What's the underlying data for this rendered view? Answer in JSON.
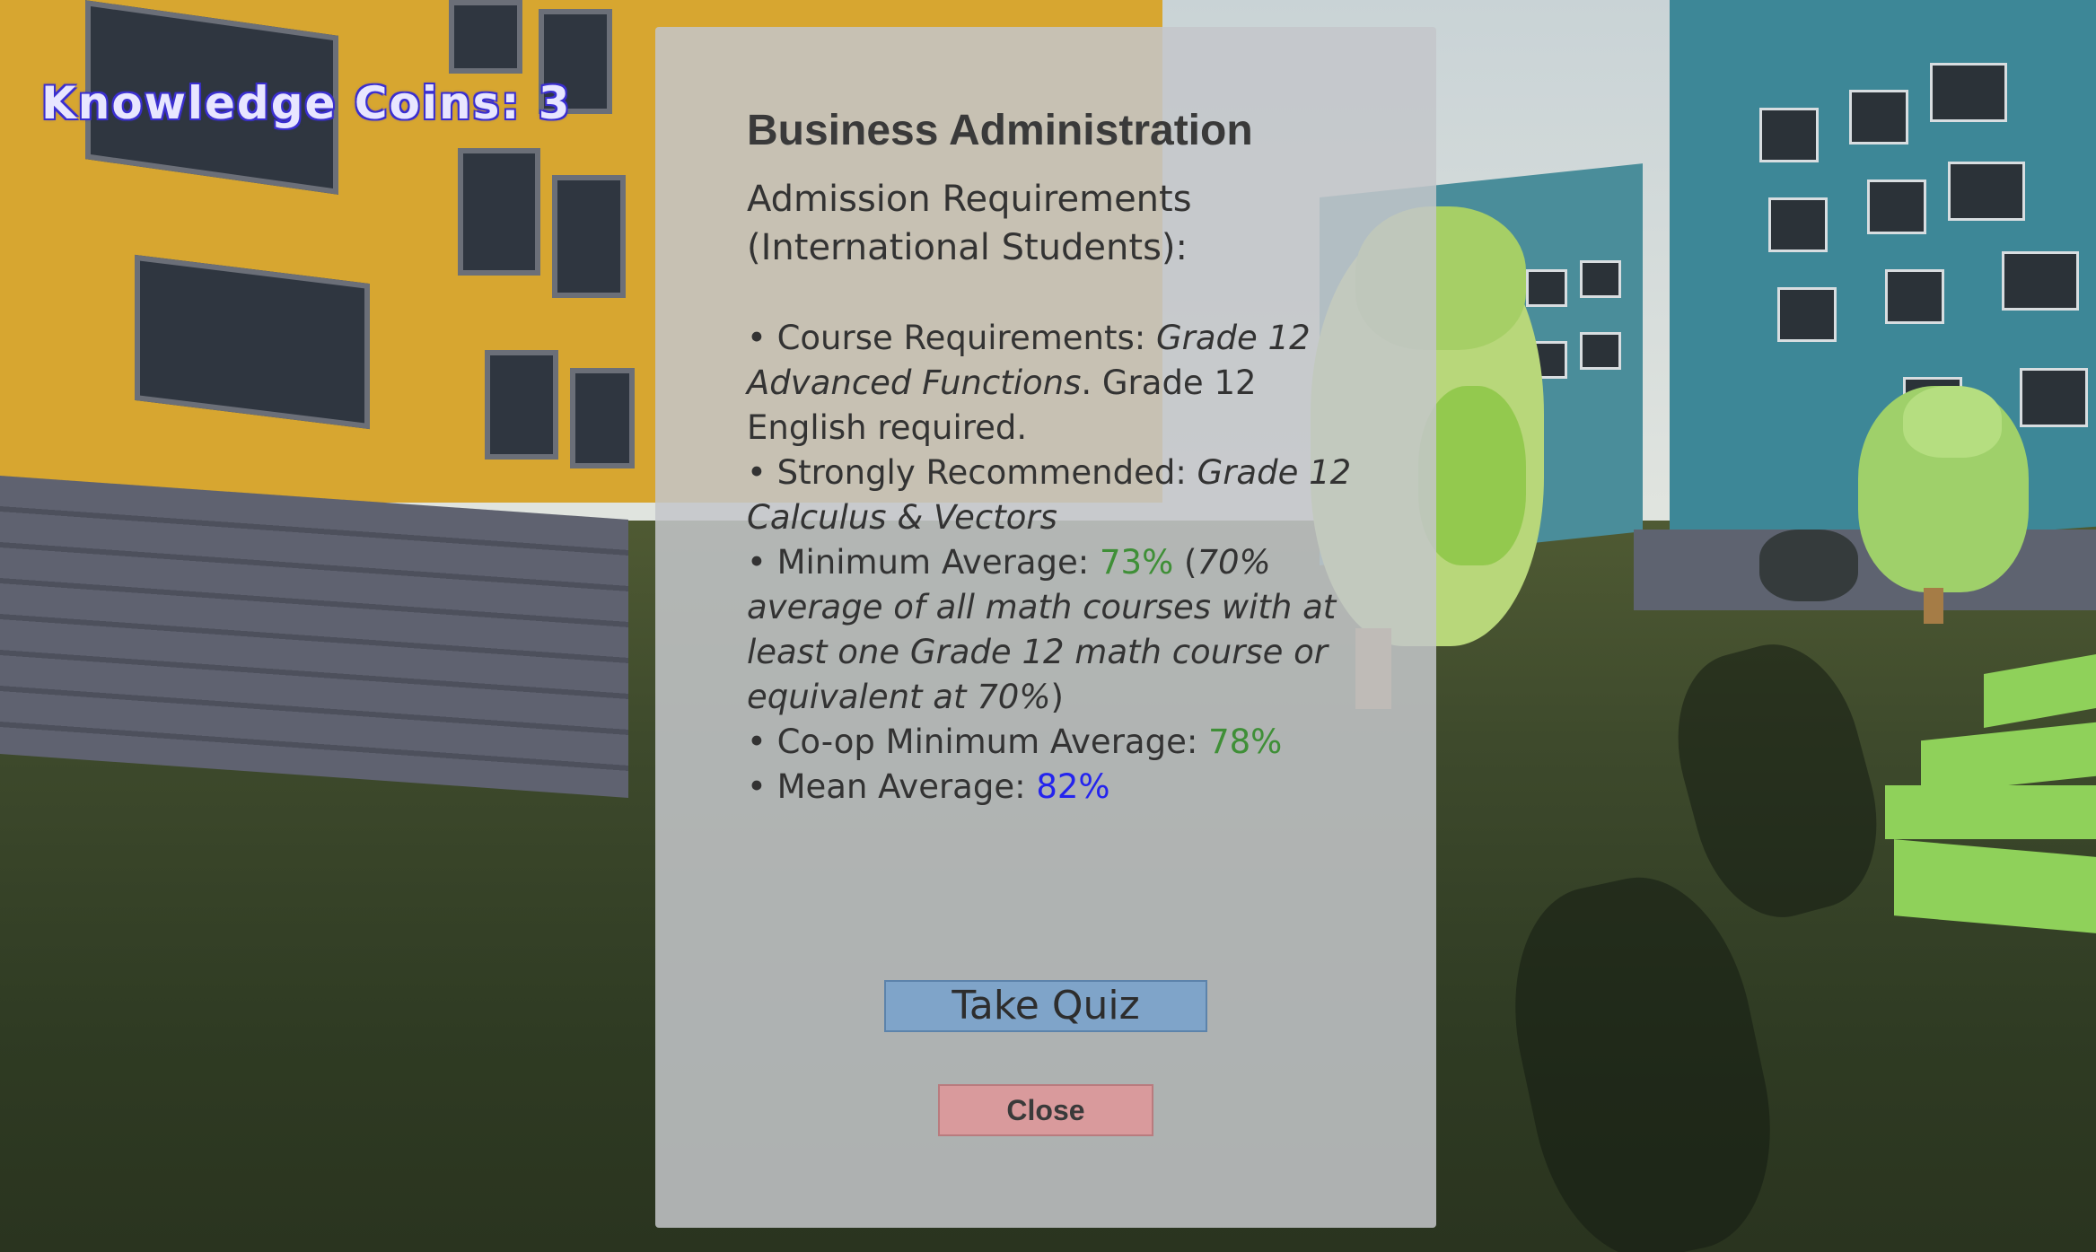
{
  "hud": {
    "coins_text": "Knowledge Coins: 3"
  },
  "dialog": {
    "title": "Business Administration",
    "subtitle": "Admission Requirements (International Students):",
    "course_label": "• Course Requirements: ",
    "course_value": "Grade 12 Advanced Functions",
    "course_tail": ". Grade 12 English required.",
    "recommended_label": "• Strongly Recommended: ",
    "recommended_value": "Grade 12 Calculus & Vectors",
    "minavg_label": "• Minimum Average: ",
    "minavg_value": "73%",
    "minavg_open": " (",
    "minavg_note": "70% average of all math courses with at least one Grade 12 math course or equivalent at 70%",
    "minavg_close": ")",
    "coop_label": "• Co-op Minimum Average: ",
    "coop_value": "78%",
    "mean_label": "• Mean Average: ",
    "mean_value": "82%",
    "quiz_button": "Take Quiz",
    "close_button": "Close"
  },
  "colors": {
    "highlight_green": "#3f8f37",
    "highlight_blue": "#2424ee",
    "quiz_button": "#7fa4c9",
    "close_button": "#d99a9c"
  }
}
